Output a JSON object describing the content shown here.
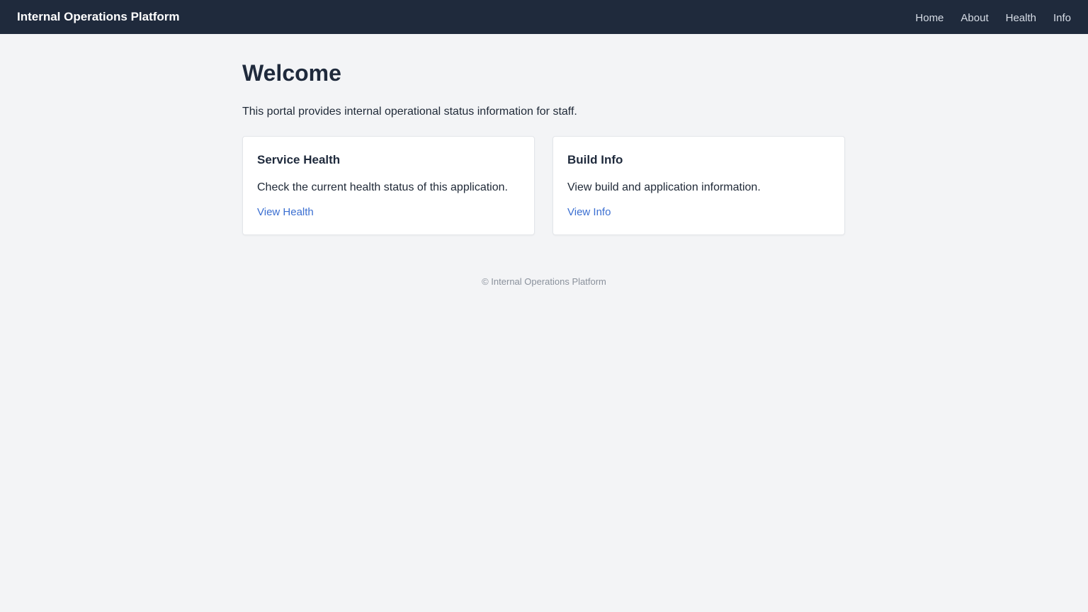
{
  "navbar": {
    "brand": "Internal Operations Platform",
    "links": [
      {
        "label": "Home"
      },
      {
        "label": "About"
      },
      {
        "label": "Health"
      },
      {
        "label": "Info"
      }
    ]
  },
  "main": {
    "title": "Welcome",
    "intro": "This portal provides internal operational status information for staff.",
    "cards": [
      {
        "title": "Service Health",
        "text": "Check the current health status of this application.",
        "link": "View Health"
      },
      {
        "title": "Build Info",
        "text": "View build and application information.",
        "link": "View Info"
      }
    ]
  },
  "footer": {
    "text": "© Internal Operations Platform"
  },
  "colors": {
    "navbar_bg": "#1f2a3c",
    "page_bg": "#f3f4f6",
    "link": "#3b6fd1"
  }
}
